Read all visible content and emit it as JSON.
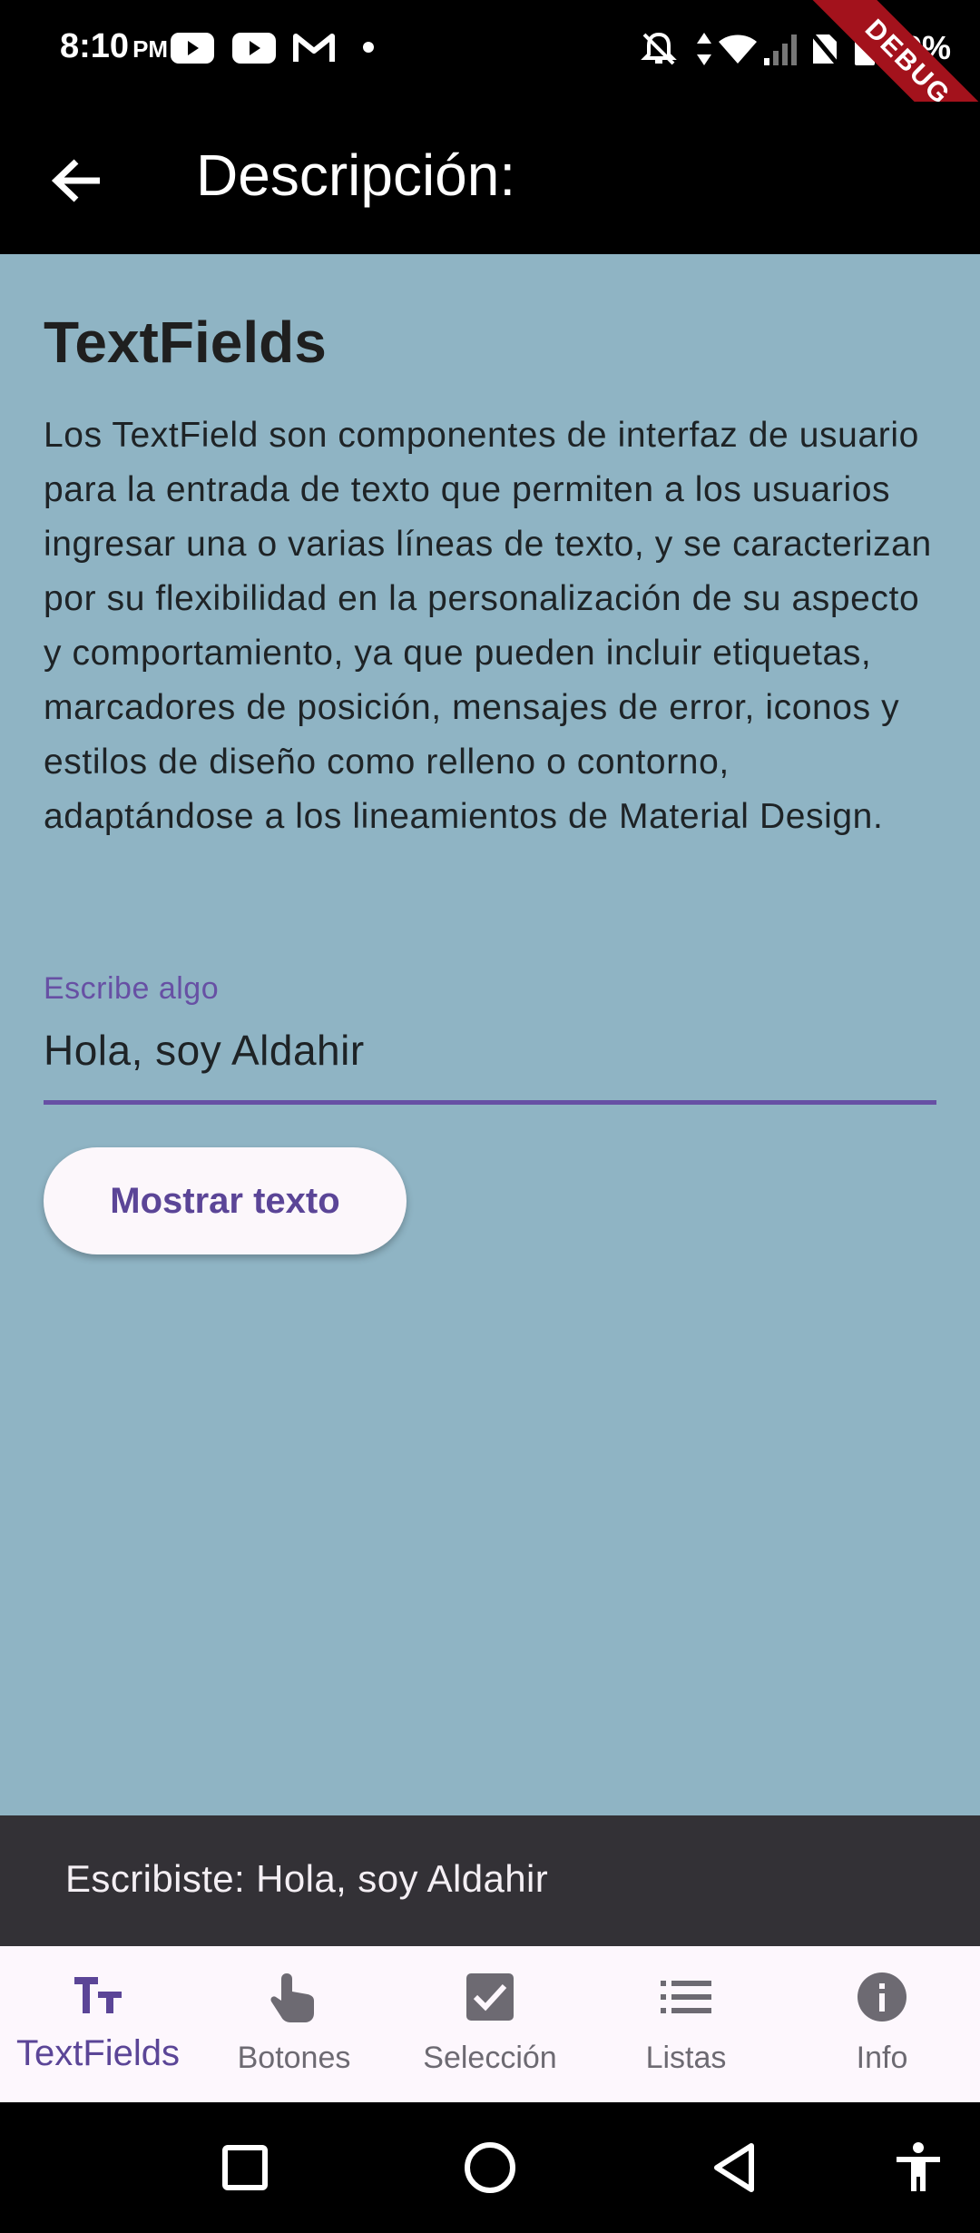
{
  "status_bar": {
    "time": "8:10",
    "ampm": "PM",
    "icons": [
      "youtube-icon",
      "youtube-icon",
      "gmail-icon",
      "dot-icon",
      "notifications-off-icon",
      "data-arrows-icon",
      "wifi-icon",
      "signal-icon",
      "no-sim-icon",
      "battery-icon"
    ],
    "battery_text": "99%",
    "debug_label": "DEBUG"
  },
  "app_bar": {
    "title": "Descripción:",
    "back_icon": "arrow-back-icon"
  },
  "content": {
    "title": "TextFields",
    "description": "Los TextField son componentes de interfaz de usuario para la entrada de texto que permiten a los usuarios ingresar una o varias líneas de texto, y se caracterizan por su flexibilidad en la personalización de su aspecto y comportamiento, ya que pueden incluir etiquetas, marcadores de posición, mensajes de error, iconos y estilos de diseño como relleno o contorno, adaptándose a los lineamientos de Material Design.",
    "field": {
      "label": "Escribe algo",
      "value": "Hola, soy Aldahir"
    },
    "button_label": "Mostrar texto"
  },
  "snackbar": {
    "text": "Escribiste: Hola, soy Aldahir"
  },
  "bottom_nav": {
    "active_index": 0,
    "items": [
      {
        "label": "TextFields",
        "icon": "text-fields-icon"
      },
      {
        "label": "Botones",
        "icon": "touch-app-icon"
      },
      {
        "label": "Selección",
        "icon": "check-box-icon"
      },
      {
        "label": "Listas",
        "icon": "list-icon"
      },
      {
        "label": "Info",
        "icon": "info-icon"
      }
    ]
  },
  "system_nav": [
    "recents-icon",
    "home-icon",
    "back-icon",
    "accessibility-icon"
  ],
  "colors": {
    "primary": "#6750a4",
    "background": "#8fb4c4",
    "app_bar": "#000000",
    "snackbar": "#333136",
    "nav_bar": "#fdf7fd"
  }
}
